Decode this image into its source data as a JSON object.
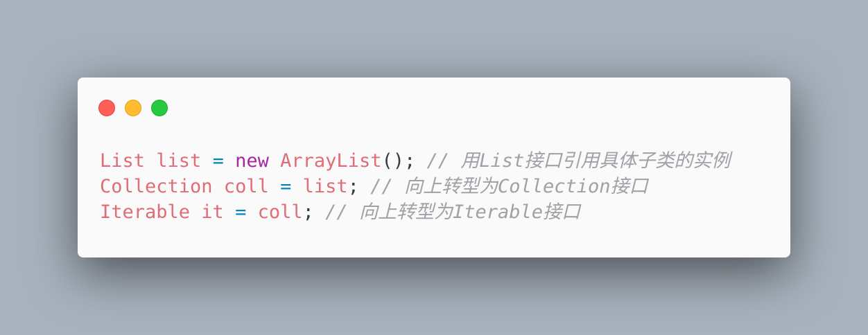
{
  "window": {
    "buttons": {
      "close_color": "#ff5f56",
      "minimize_color": "#ffbd2e",
      "maximize_color": "#27c93f"
    }
  },
  "colors": {
    "background": "#a8b2bd",
    "card": "#fafafa",
    "identifier": "#e06c75",
    "operator": "#0184bc",
    "keyword": "#a626a4",
    "comment": "#a0a1a7"
  },
  "code": {
    "lines": [
      {
        "tokens": [
          {
            "type": "ident",
            "text": "List list"
          },
          {
            "type": "space",
            "text": " "
          },
          {
            "type": "op",
            "text": "="
          },
          {
            "type": "space",
            "text": " "
          },
          {
            "type": "kw",
            "text": "new"
          },
          {
            "type": "space",
            "text": " "
          },
          {
            "type": "ident",
            "text": "ArrayList"
          },
          {
            "type": "punct",
            "text": "();"
          },
          {
            "type": "space",
            "text": " "
          },
          {
            "type": "comment",
            "text": "// 用List接口引用具体子类的实例"
          }
        ]
      },
      {
        "tokens": [
          {
            "type": "ident",
            "text": "Collection coll"
          },
          {
            "type": "space",
            "text": " "
          },
          {
            "type": "op",
            "text": "="
          },
          {
            "type": "space",
            "text": " "
          },
          {
            "type": "ident",
            "text": "list"
          },
          {
            "type": "punct",
            "text": ";"
          },
          {
            "type": "space",
            "text": " "
          },
          {
            "type": "comment",
            "text": "// 向上转型为Collection接口"
          }
        ]
      },
      {
        "tokens": [
          {
            "type": "ident",
            "text": "Iterable it"
          },
          {
            "type": "space",
            "text": " "
          },
          {
            "type": "op",
            "text": "="
          },
          {
            "type": "space",
            "text": " "
          },
          {
            "type": "ident",
            "text": "coll"
          },
          {
            "type": "punct",
            "text": ";"
          },
          {
            "type": "space",
            "text": " "
          },
          {
            "type": "comment",
            "text": "// 向上转型为Iterable接口"
          }
        ]
      }
    ]
  }
}
